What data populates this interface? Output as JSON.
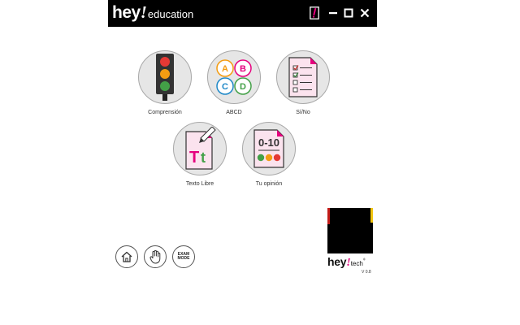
{
  "app": {
    "brand_hey": "hey",
    "brand_excl": "!",
    "brand_suffix": "education"
  },
  "window_controls": [
    "hey-logo-icon",
    "minimize-icon",
    "maximize-icon",
    "close-icon"
  ],
  "activities": [
    {
      "label": "Comprensión",
      "icon": "traffic-light-icon"
    },
    {
      "label": "ABCD",
      "icon": "abcd-options-icon"
    },
    {
      "label": "Sí/No",
      "icon": "checklist-icon"
    },
    {
      "label": "Texto Libre",
      "icon": "free-text-icon",
      "glyph": "Tt"
    },
    {
      "label": "Tu opinión",
      "icon": "rating-icon",
      "glyph": "0-10"
    }
  ],
  "abcd_letters": [
    "A",
    "B",
    "C",
    "D"
  ],
  "bottom": {
    "home": "home-icon",
    "hand": "hand-icon",
    "exam_line1": "EXAM",
    "exam_line2": "MODE"
  },
  "tech": {
    "hey": "hey",
    "excl": "!",
    "word": "tech",
    "reg": "®",
    "version": "V 0.8"
  },
  "colors": {
    "red": "#e53935",
    "orange": "#f39c12",
    "green": "#43a047",
    "magenta": "#e6007e",
    "blue": "#1e88c7",
    "pink_paper": "#fbe3ee"
  }
}
